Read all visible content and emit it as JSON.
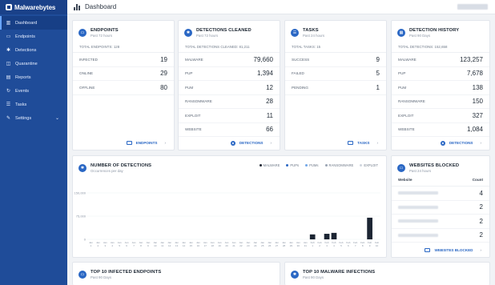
{
  "app": {
    "brand": "Malwarebytes"
  },
  "topbar": {
    "title": "Dashboard"
  },
  "sidebar": {
    "items": [
      {
        "label": "Dashboard",
        "icon": "dashboard-icon"
      },
      {
        "label": "Endpoints",
        "icon": "monitor-icon"
      },
      {
        "label": "Detections",
        "icon": "detections-icon"
      },
      {
        "label": "Quarantine",
        "icon": "quarantine-icon"
      },
      {
        "label": "Reports",
        "icon": "reports-icon"
      },
      {
        "label": "Events",
        "icon": "events-icon"
      },
      {
        "label": "Tasks",
        "icon": "tasks-icon"
      },
      {
        "label": "Settings",
        "icon": "settings-icon"
      }
    ]
  },
  "cards": {
    "endpoints": {
      "title": "ENDPOINTS",
      "sub": "Past 72 hours",
      "total": "TOTAL ENDPOINTS: 128",
      "rows": [
        {
          "label": "INFECTED",
          "value": "19"
        },
        {
          "label": "ONLINE",
          "value": "29"
        },
        {
          "label": "OFFLINE",
          "value": "80"
        }
      ],
      "link": "ENDPOINTS"
    },
    "detections": {
      "title": "DETECTIONS CLEANED",
      "sub": "Past 72 hours",
      "total": "TOTAL DETECTIONS CLEANED: 81,211",
      "rows": [
        {
          "label": "MALWARE",
          "value": "79,660"
        },
        {
          "label": "PUP",
          "value": "1,394"
        },
        {
          "label": "PUM",
          "value": "12"
        },
        {
          "label": "RANSOMWARE",
          "value": "28"
        },
        {
          "label": "EXPLOIT",
          "value": "11"
        },
        {
          "label": "WEBSITE",
          "value": "66"
        }
      ],
      "link": "DETECTIONS"
    },
    "tasks": {
      "title": "TASKS",
      "sub": "Past 24 hours",
      "total": "TOTAL TASKS: 15",
      "rows": [
        {
          "label": "SUCCESS",
          "value": "9"
        },
        {
          "label": "FAILED",
          "value": "5"
        },
        {
          "label": "PENDING",
          "value": "1"
        }
      ],
      "link": "TASKS"
    },
    "history": {
      "title": "DETECTION HISTORY",
      "sub": "Past 90 Days",
      "total": "TOTAL DETECTIONS: 152,658",
      "rows": [
        {
          "label": "MALWARE",
          "value": "123,257"
        },
        {
          "label": "PUP",
          "value": "7,678"
        },
        {
          "label": "PUM",
          "value": "138"
        },
        {
          "label": "RANSOMWARE",
          "value": "150"
        },
        {
          "label": "EXPLOIT",
          "value": "327"
        },
        {
          "label": "WEBSITE",
          "value": "1,084"
        }
      ],
      "link": "DETECTIONS"
    },
    "chart": {
      "title": "NUMBER OF DETECTIONS",
      "sub": "Occurrences per day",
      "legend": [
        {
          "name": "MALWARE",
          "color": "#1c2533"
        },
        {
          "name": "PUPs",
          "color": "#2a67c4"
        },
        {
          "name": "PUMs",
          "color": "#6fa6e8"
        },
        {
          "name": "RANSOMWARE",
          "color": "#9aa4b3"
        },
        {
          "name": "EXPLOIT",
          "color": "#d0d6df"
        }
      ]
    },
    "websites": {
      "title": "WEBSITES BLOCKED",
      "sub": "Past 24 hours",
      "col_website": "Website",
      "col_count": "Count",
      "counts": [
        "4",
        "2",
        "2",
        "2"
      ],
      "link": "WEBSITES BLOCKED"
    },
    "top_endpoints": {
      "title": "TOP 10 INFECTED ENDPOINTS",
      "sub": "Past 90 Days"
    },
    "top_malware": {
      "title": "TOP 10 MALWARE INFECTIONS",
      "sub": "Past 90 Days"
    }
  },
  "chart_data": {
    "type": "bar",
    "title": "NUMBER OF DETECTIONS",
    "ylabel": "",
    "xlabel": "",
    "ylim": [
      0,
      150000
    ],
    "yticks": [
      "150,000",
      "75,000",
      "0"
    ],
    "categories": [
      "Jan 1",
      "Jan 2",
      "Jan 3",
      "Jan 4",
      "Jan 5",
      "Jan 6",
      "Jan 7",
      "Jan 8",
      "Jan 9",
      "Jan 10",
      "Jan 11",
      "Jan 12",
      "Jan 13",
      "Jan 14",
      "Jan 15",
      "Jan 16",
      "Jan 17",
      "Jan 18",
      "Jan 19",
      "Jan 20",
      "Jan 21",
      "Jan 22",
      "Jan 23",
      "Jan 24",
      "Jan 25",
      "Jan 26",
      "Jan 27",
      "Jan 28",
      "Jan 29",
      "Jan 30",
      "Jan 31",
      "Feb 1",
      "Feb 2",
      "Feb 3",
      "Feb 4",
      "Feb 5",
      "Feb 6",
      "Feb 7",
      "Feb 8",
      "Feb 9",
      "Feb 10"
    ],
    "series": [
      {
        "name": "MALWARE",
        "values": [
          0,
          0,
          0,
          0,
          0,
          0,
          0,
          0,
          0,
          0,
          0,
          0,
          0,
          0,
          0,
          0,
          0,
          0,
          0,
          0,
          0,
          0,
          0,
          0,
          0,
          0,
          0,
          0,
          0,
          0,
          0,
          16000,
          0,
          18000,
          21000,
          0,
          0,
          0,
          0,
          70000,
          0
        ]
      }
    ],
    "grid": true,
    "legend": "top-right"
  }
}
